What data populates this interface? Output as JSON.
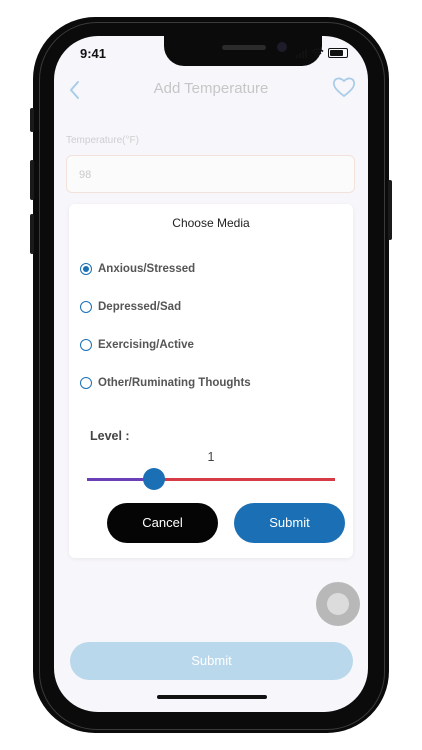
{
  "status_bar": {
    "time": "9:41"
  },
  "header": {
    "title": "Add Temperature",
    "back_icon": "chevron-left-icon",
    "favorite_icon": "heart-outline-icon"
  },
  "form": {
    "temperature_label": "Temperature(°F)",
    "temperature_value": "98",
    "submit_label": "Submit"
  },
  "modal": {
    "title": "Choose Media",
    "options": [
      {
        "label": "Anxious/Stressed",
        "selected": true
      },
      {
        "label": "Depressed/Sad",
        "selected": false
      },
      {
        "label": "Exercising/Active",
        "selected": false
      },
      {
        "label": "Other/Ruminating Thoughts",
        "selected": false
      }
    ],
    "level_label": "Level :",
    "level_value": "1",
    "cancel_label": "Cancel",
    "submit_label": "Submit"
  },
  "colors": {
    "accent": "#1a6fb5",
    "slider_left": "#6b3fb8",
    "slider_right": "#d63a44",
    "cancel_bg": "#050505"
  }
}
